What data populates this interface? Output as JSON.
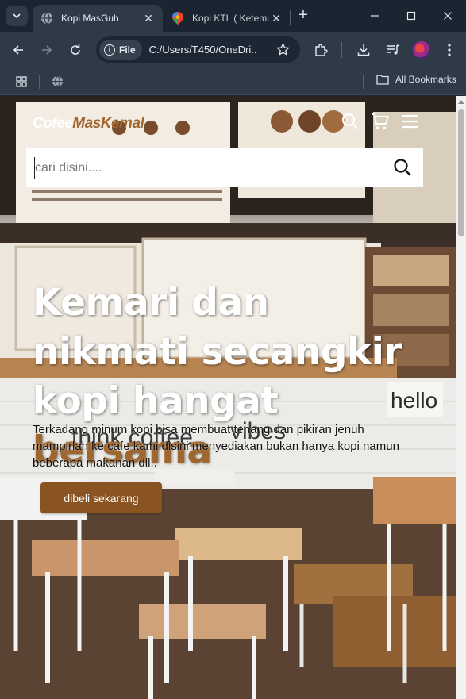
{
  "browser": {
    "tabs": [
      {
        "title": "Kopi MasGuh",
        "active": true
      },
      {
        "title": "Kopi KTL ( Ketemu",
        "active": false
      }
    ],
    "address": {
      "chip_label": "File",
      "url": "C:/Users/T450/OneDri..."
    },
    "bookmarks": {
      "all_label": "All Bookmarks"
    }
  },
  "site": {
    "logo_part1": "Cofee",
    "logo_part2": "MasKemal",
    "search_placeholder": "cari disini....",
    "hero": {
      "title_main": "Kemari dan nikmati secangkir kopi hangat ",
      "title_accent": "bersama",
      "description": "Terkadang minum kopi bisa membuat tenang dan pikiran jenuh mampirlah ke cafe kami disini menyediakan bukan hanya kopi namun beberapa makanan dll..",
      "cta_label": "dibeli sekarang"
    }
  },
  "colors": {
    "accent": "#a0662f",
    "cta": "#8a5322",
    "chrome_bg": "#2e3a47"
  }
}
